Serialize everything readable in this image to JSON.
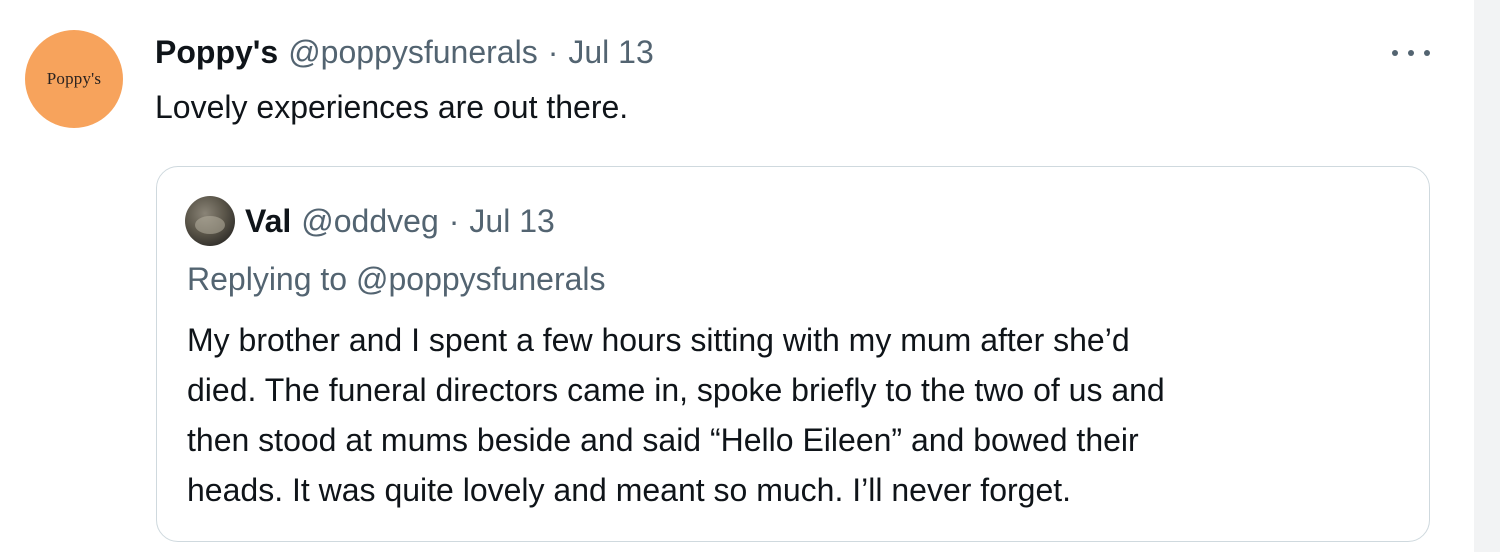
{
  "tweet": {
    "avatar_text": "Poppy's",
    "avatar_color": "#f7a35c",
    "display_name": "Poppy's",
    "handle": "@poppysfunerals",
    "separator": "·",
    "date": "Jul 13",
    "text": "Lovely experiences are out there.",
    "more_icon": "more-horizontal-icon"
  },
  "quote": {
    "display_name": "Val",
    "handle": "@oddveg",
    "separator": "·",
    "date": "Jul 13",
    "replying_to": "Replying to @poppysfunerals",
    "lines": [
      "My brother and I spent a few hours sitting with my mum after she’d",
      "died. The funeral directors came in, spoke briefly to the two of us and",
      "then stood at mums beside and said “Hello Eileen” and bowed their",
      "heads. It was quite lovely and meant so much. I’ll never forget."
    ]
  },
  "colors": {
    "primary_text": "#0f1419",
    "secondary_text": "#536471",
    "border": "#cfd9de"
  }
}
